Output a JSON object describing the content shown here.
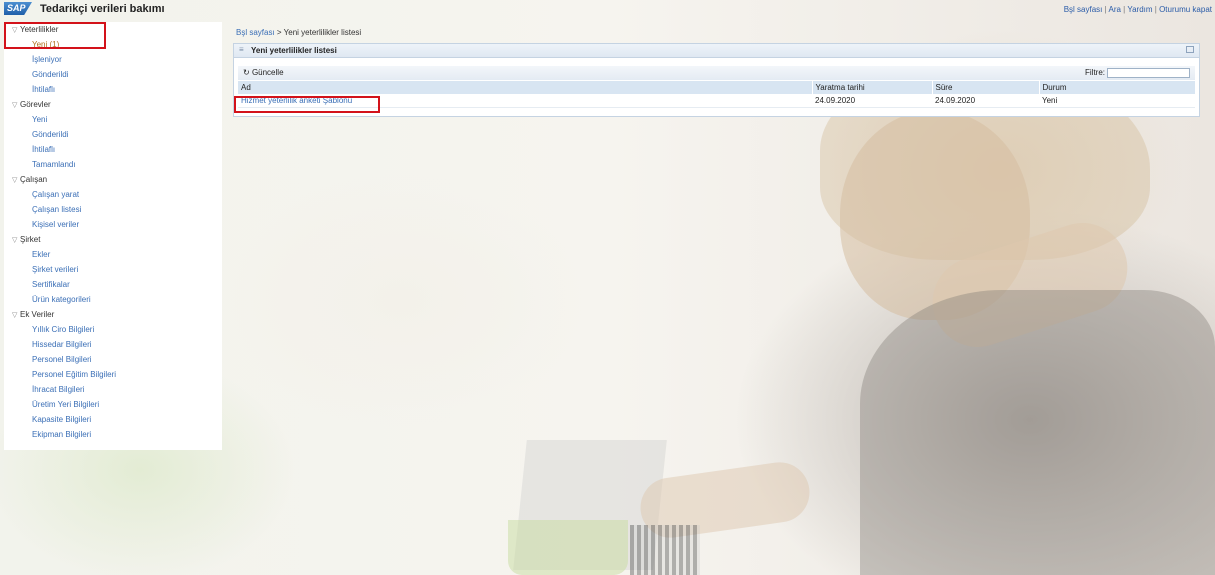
{
  "header": {
    "logo": "SAP",
    "title": "Tedarikçi verileri bakımı",
    "links": [
      "Bşl sayfası",
      "Ara",
      "Yardım",
      "Oturumu kapat"
    ],
    "separator": " | "
  },
  "sidebar": {
    "groups": [
      {
        "label": "Yeterlilikler",
        "items": [
          "Yeni (1)",
          "İşleniyor",
          "Gönderildi",
          "İhtilaflı"
        ]
      },
      {
        "label": "Görevler",
        "items": [
          "Yeni",
          "Gönderildi",
          "İhtilaflı",
          "Tamamlandı"
        ]
      },
      {
        "label": "Çalışan",
        "items": [
          "Çalışan yarat",
          "Çalışan listesi",
          "Kişisel veriler"
        ]
      },
      {
        "label": "Şirket",
        "items": [
          "Ekler",
          "Şirket verileri",
          "Sertifikalar",
          "Ürün kategorileri"
        ]
      },
      {
        "label": "Ek Veriler",
        "items": [
          "Yıllık Ciro Bilgileri",
          "Hissedar Bilgileri",
          "Personel Bilgileri",
          "Personel Eğitim Bilgileri",
          "İhracat Bilgileri",
          "Üretim Yeri Bilgileri",
          "Kapasite Bilgileri",
          "Ekipman Bilgileri"
        ]
      }
    ]
  },
  "breadcrumb": {
    "home": "Bşl sayfası",
    "separator": ">",
    "current": "Yeni yeterlilikler listesi"
  },
  "panel": {
    "title": "Yeni yeterlilikler listesi",
    "refresh_label": "Güncelle",
    "filter_label": "Filtre:",
    "filter_value": "",
    "columns": [
      "Ad",
      "Yaratma tarihi",
      "Süre",
      "Durum"
    ],
    "rows": [
      {
        "ad": "Hizmet yeterlilik anketi Şablonu",
        "yaratma_tarihi": "24.09.2020",
        "sure": "24.09.2020",
        "durum": "Yeni"
      }
    ]
  },
  "icons": {
    "refresh": "refresh-icon",
    "expand": "triangle-down-icon",
    "maximize": "maximize-icon",
    "panel_menu": "menu-icon"
  },
  "colors": {
    "link": "#3b6fb6",
    "selected": "#b0701c",
    "highlight": "#d3121a",
    "panel_header": "#dfe8f2"
  }
}
